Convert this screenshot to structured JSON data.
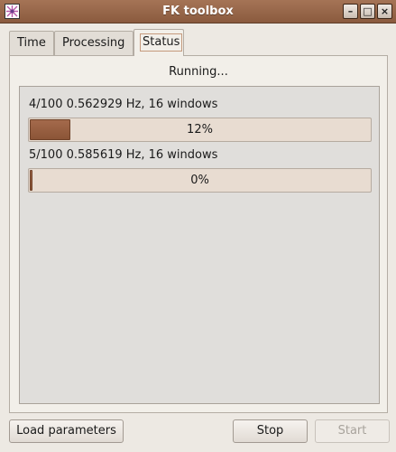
{
  "window": {
    "title": "FK toolbox",
    "icon": "app-icon"
  },
  "titlebar_buttons": {
    "minimize": "–",
    "maximize": "□",
    "close": "×"
  },
  "tabs": [
    {
      "label": "Time",
      "active": false
    },
    {
      "label": "Processing",
      "active": false
    },
    {
      "label": "Status",
      "active": true
    }
  ],
  "status": {
    "text": "Running..."
  },
  "jobs": [
    {
      "label": "4/100 0.562929 Hz, 16 windows",
      "progress_percent": 12,
      "progress_text": "12%"
    },
    {
      "label": "5/100 0.585619 Hz, 16 windows",
      "progress_percent": 0,
      "progress_text": "0%"
    }
  ],
  "buttons": {
    "load": "Load parameters",
    "stop": "Stop",
    "start": "Start",
    "start_enabled": false
  },
  "colors": {
    "titlebar": "#8a5a3e",
    "progress_fill": "#9a6042",
    "progress_track": "#e8dcd1"
  }
}
